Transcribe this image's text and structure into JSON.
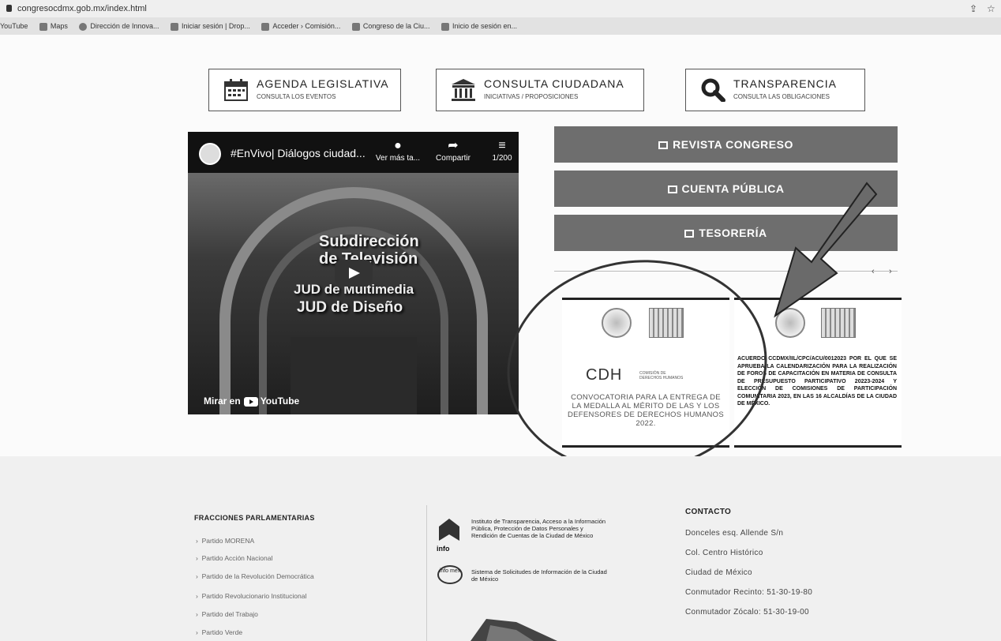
{
  "browser": {
    "url": "congresocdmx.gob.mx/index.html",
    "bookmarks": [
      "YouTube",
      "Maps",
      "Dirección de Innova...",
      "Iniciar sesión | Drop...",
      "Acceder › Comisión...",
      "Congreso de la Ciu...",
      "Inicio de sesión en..."
    ]
  },
  "top_buttons": [
    {
      "title": "AGENDA LEGISLATIVA",
      "subtitle": "CONSULTA LOS EVENTOS",
      "icon": "calendar-icon"
    },
    {
      "title": "CONSULTA CIUDADANA",
      "subtitle": "INICIATIVAS / PROPOSICIONES",
      "icon": "building-icon"
    },
    {
      "title": "TRANSPARENCIA",
      "subtitle": "CONSULTA LAS OBLIGACIONES",
      "icon": "search-icon"
    }
  ],
  "video": {
    "title": "#EnVivo| Diálogos ciudad...",
    "watch_later": "Ver más ta...",
    "share": "Compartir",
    "playlist": "1/200",
    "overlay_lines": [
      "Subdirección",
      "de Televisión",
      "JUD de Multimedia",
      "JUD de Diseño"
    ],
    "watch_on": "Mirar en",
    "youtube": "YouTube"
  },
  "side_buttons": [
    "REVISTA CONGRESO",
    "CUENTA PÚBLICA",
    "TESORERÍA"
  ],
  "carousel": {
    "prev": "‹",
    "next": "›",
    "card1": {
      "logo": "CDH",
      "logo_sub": "COMISIÓN DE DERECHOS HUMANOS",
      "text": "CONVOCATORIA PARA LA ENTREGA DE LA MEDALLA AL MÉRITO DE LAS Y LOS DEFENSORES DE DERECHOS HUMANOS 2022."
    },
    "card2": {
      "text": "ACUERDO CCDMX/IIL/CPC/ACU/0012023 POR EL QUE SE APRUEBA LA CALENDARIZACIÓN PARA LA REALIZACIÓN DE FOROS DE CAPACITACIÓN EN MATERIA DE CONSULTA DE PRESUPUESTO PARTICIPATIVO 20223-2024 Y ELECCIÓN DE COMISIONES DE PARTICIPACIÓN COMUNITARIA 2023, EN LAS 16 ALCALDÍAS DE LA CIUDAD DE MÉXICO."
    }
  },
  "footer": {
    "fracciones_title": "FRACCIONES PARLAMENTARIAS",
    "fracciones": [
      "Partido MORENA",
      "Partido Acción Nacional",
      "Partido de la Revolución Democrática",
      "Partido Revolucionario Institucional",
      "Partido del Trabajo",
      "Partido Verde"
    ],
    "info_text": "Instituto de Transparencia, Acceso a la Información Pública, Protección de Datos Personales y Rendición de Cuentas de la Ciudad de México",
    "info_logo": "info",
    "infomex_logo": "info mex",
    "infomex_text": "Sistema de Solicitudes de Información de la Ciudad de México",
    "contacto_title": "CONTACTO",
    "contacto": [
      "Donceles esq. Allende S/n",
      "Col. Centro Histórico",
      "Ciudad de México",
      "Conmutador Recinto: 51-30-19-80",
      "Conmutador Zócalo: 51-30-19-00"
    ]
  }
}
